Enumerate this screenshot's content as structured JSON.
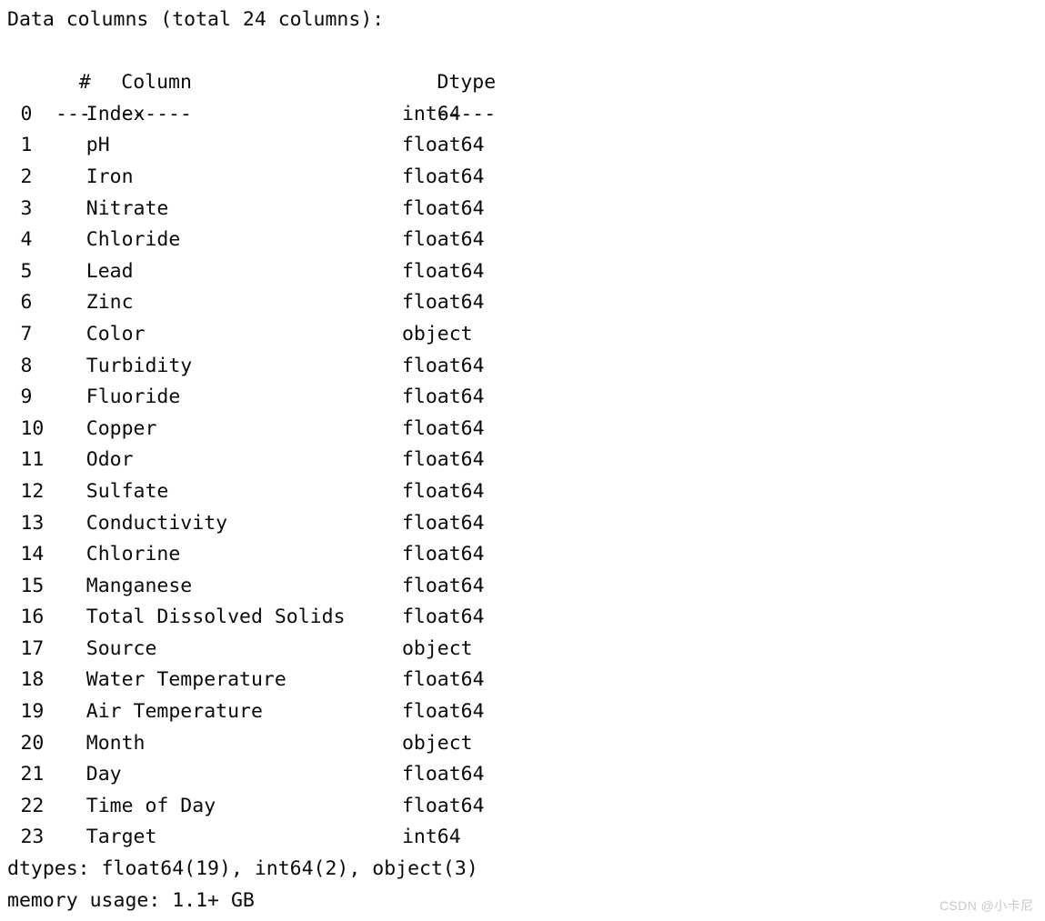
{
  "terminal": {
    "header_line": "Data columns (total 24 columns):",
    "column_header": {
      "num": "  # ",
      "name": "Column",
      "dtype": "Dtype"
    },
    "separator": {
      "num": "---",
      "name": "------",
      "dtype": "-----"
    },
    "rows": [
      {
        "index": "0",
        "name": "Index",
        "dtype": "int64"
      },
      {
        "index": "1",
        "name": "pH",
        "dtype": "float64"
      },
      {
        "index": "2",
        "name": "Iron",
        "dtype": "float64"
      },
      {
        "index": "3",
        "name": "Nitrate",
        "dtype": "float64"
      },
      {
        "index": "4",
        "name": "Chloride",
        "dtype": "float64"
      },
      {
        "index": "5",
        "name": "Lead",
        "dtype": "float64"
      },
      {
        "index": "6",
        "name": "Zinc",
        "dtype": "float64"
      },
      {
        "index": "7",
        "name": "Color",
        "dtype": "object"
      },
      {
        "index": "8",
        "name": "Turbidity",
        "dtype": "float64"
      },
      {
        "index": "9",
        "name": "Fluoride",
        "dtype": "float64"
      },
      {
        "index": "10",
        "name": "Copper",
        "dtype": "float64"
      },
      {
        "index": "11",
        "name": "Odor",
        "dtype": "float64"
      },
      {
        "index": "12",
        "name": "Sulfate",
        "dtype": "float64"
      },
      {
        "index": "13",
        "name": "Conductivity",
        "dtype": "float64"
      },
      {
        "index": "14",
        "name": "Chlorine",
        "dtype": "float64"
      },
      {
        "index": "15",
        "name": "Manganese",
        "dtype": "float64"
      },
      {
        "index": "16",
        "name": "Total Dissolved Solids",
        "dtype": "float64"
      },
      {
        "index": "17",
        "name": "Source",
        "dtype": "object"
      },
      {
        "index": "18",
        "name": "Water Temperature",
        "dtype": "float64"
      },
      {
        "index": "19",
        "name": "Air Temperature",
        "dtype": "float64"
      },
      {
        "index": "20",
        "name": "Month",
        "dtype": "object"
      },
      {
        "index": "21",
        "name": "Day",
        "dtype": "float64"
      },
      {
        "index": "22",
        "name": "Time of Day",
        "dtype": "float64"
      },
      {
        "index": "23",
        "name": "Target",
        "dtype": "int64"
      }
    ],
    "dtypes_summary": "dtypes: float64(19), int64(2), object(3)",
    "memory_usage": "memory usage: 1.1+ GB"
  },
  "watermark": {
    "text": "CSDN @小卡尼"
  },
  "colors": {
    "background": "#ffffff",
    "text": "#0a0a0a",
    "watermark": "#c9c9c9"
  }
}
